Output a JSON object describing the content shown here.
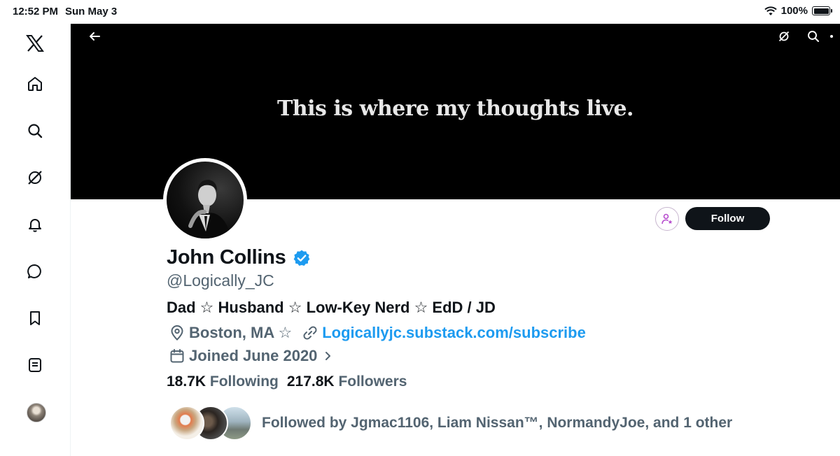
{
  "status_bar": {
    "time": "12:52 PM",
    "date": "Sun May 3",
    "battery": "100%"
  },
  "sidebar": {
    "items": [
      {
        "icon": "x-logo-icon"
      },
      {
        "icon": "home-icon"
      },
      {
        "icon": "search-icon"
      },
      {
        "icon": "grok-icon"
      },
      {
        "icon": "bell-icon"
      },
      {
        "icon": "chat-bubble-icon"
      },
      {
        "icon": "bookmark-icon"
      },
      {
        "icon": "lists-icon"
      },
      {
        "icon": "avatar"
      }
    ]
  },
  "banner": {
    "tagline": "This is where my thoughts live."
  },
  "profile": {
    "name": "John Collins",
    "verified": true,
    "handle": "@Logically_JC",
    "bio": "Dad ☆ Husband ☆ Low-Key Nerd ☆ EdD / JD",
    "location": "Boston, MA ☆",
    "website": "Logicallyjc.substack.com/subscribe",
    "joined": "Joined June 2020",
    "following_count": "18.7K",
    "following_label": "Following",
    "followers_count": "217.8K",
    "followers_label": "Followers",
    "followed_by": "Followed by Jgmac1106, Liam Nissan™, NormandyJoe, and 1 other"
  },
  "actions": {
    "follow_label": "Follow"
  },
  "colors": {
    "link": "#1d9bf0",
    "verified": "#1d9bf0",
    "muted": "#536471",
    "text": "#0f1419",
    "subscribe_accent": "#b84fcf"
  }
}
